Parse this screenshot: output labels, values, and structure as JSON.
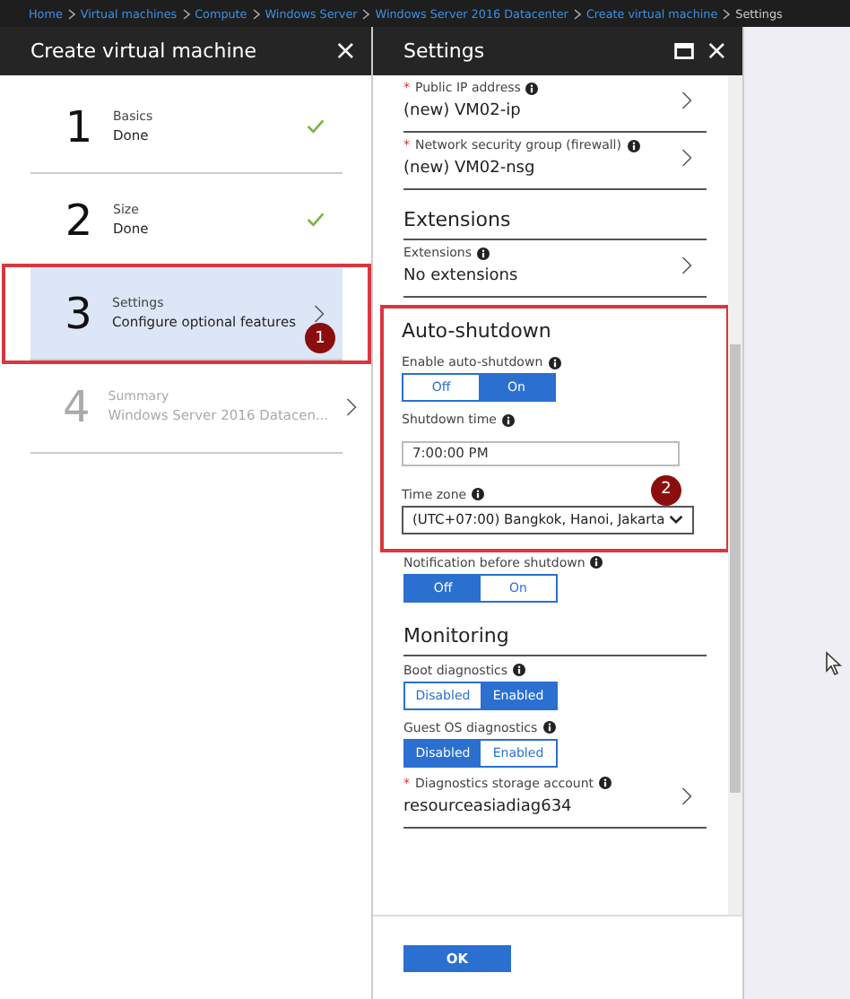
{
  "breadcrumb": [
    "Home",
    "Virtual machines",
    "Compute",
    "Windows Server",
    "Windows Server 2016 Datacenter",
    "Create virtual machine",
    "Settings"
  ],
  "left_blade": {
    "title": "Create virtual machine",
    "close": "×",
    "steps": [
      {
        "number": "1",
        "title": "Basics",
        "subtitle": "Done",
        "done": true,
        "selected": false,
        "disabled": false
      },
      {
        "number": "2",
        "title": "Size",
        "subtitle": "Done",
        "done": true,
        "selected": false,
        "disabled": false
      },
      {
        "number": "3",
        "title": "Settings",
        "subtitle": "Configure optional features",
        "done": false,
        "selected": true,
        "disabled": false,
        "annotation": "1"
      },
      {
        "number": "4",
        "title": "Summary",
        "subtitle": "Windows Server 2016 Datacen...",
        "done": false,
        "selected": false,
        "disabled": true
      }
    ]
  },
  "settings": {
    "title": "Settings",
    "close": "×",
    "ok": "OK",
    "items": [
      {
        "kind": "nav",
        "marker": "*",
        "label": "Public IP address",
        "value": "(new) VM02-ip"
      },
      {
        "kind": "nav",
        "marker": "*",
        "label": "Network security group (firewall)",
        "value": "(new) VM02-nsg"
      },
      {
        "kind": "heading",
        "label": "Extensions"
      },
      {
        "kind": "nav",
        "label": "Extensions",
        "value": "No extensions"
      },
      {
        "kind": "group",
        "annotation": "2",
        "items": [
          {
            "kind": "heading",
            "label": "Auto-shutdown"
          },
          {
            "kind": "toggle",
            "label": "Enable auto-shutdown",
            "options": [
              {
                "label": "Off",
                "selected": false
              },
              {
                "label": "On",
                "selected": true
              }
            ]
          },
          {
            "kind": "input",
            "label": "Shutdown time",
            "value": "7:00:00 PM"
          },
          {
            "kind": "select",
            "label": "Time zone",
            "value": "(UTC+07:00) Bangkok, Hanoi, Jakarta"
          }
        ]
      },
      {
        "kind": "toggle",
        "label": "Notification before shutdown",
        "options": [
          {
            "label": "Off",
            "selected": true
          },
          {
            "label": "On",
            "selected": false
          }
        ]
      },
      {
        "kind": "heading",
        "label": "Monitoring"
      },
      {
        "kind": "toggle",
        "label": "Boot diagnostics",
        "options": [
          {
            "label": "Disabled",
            "selected": false
          },
          {
            "label": "Enabled",
            "selected": true
          }
        ]
      },
      {
        "kind": "toggle",
        "label": "Guest OS diagnostics",
        "options": [
          {
            "label": "Disabled",
            "selected": true
          },
          {
            "label": "Enabled",
            "selected": false
          }
        ]
      },
      {
        "kind": "nav",
        "marker": "*",
        "label": "Diagnostics storage account",
        "value": "resourceasiadiag634"
      }
    ]
  }
}
